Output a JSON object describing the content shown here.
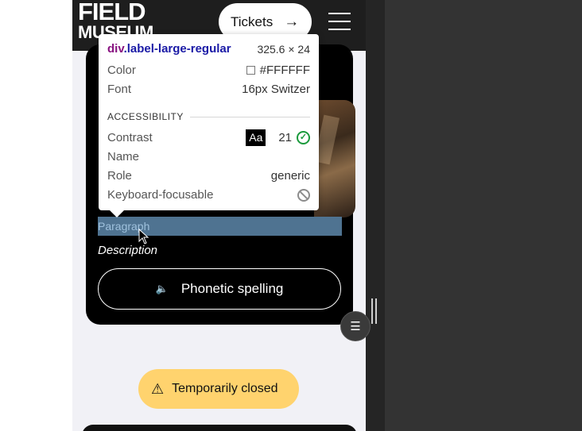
{
  "header": {
    "logo_line1": "FIELD",
    "logo_line2": "MUSEUM",
    "tickets_label": "Tickets",
    "tickets_icon": "arrow-right-icon",
    "menu_icon": "hamburger-menu-icon"
  },
  "card": {
    "paragraph": "Paragraph",
    "description": "Description",
    "phonetic_label": "Phonetic spelling",
    "phonetic_icon": "speaker-icon"
  },
  "status": {
    "closed_label": "Temporarily closed",
    "closed_icon": "warning-icon"
  },
  "inspector_tooltip": {
    "tag": "div",
    "class_name": ".label-large-regular",
    "dimensions": "325.6 × 24",
    "color_label": "Color",
    "color_value": "#FFFFFF",
    "font_label": "Font",
    "font_value": "16px Switzer",
    "section_title": "ACCESSIBILITY",
    "contrast_label": "Contrast",
    "contrast_badge": "Aa",
    "contrast_value": "21",
    "name_label": "Name",
    "role_label": "Role",
    "role_value": "generic",
    "keyboard_label": "Keyboard-focusable"
  },
  "colors": {
    "header_bg": "#1e1e1e",
    "card_bg": "#000000",
    "selection_highlight": "#4f7391",
    "closed_pill_bg": "#ffd36e",
    "devtools_bg": "#333333"
  }
}
